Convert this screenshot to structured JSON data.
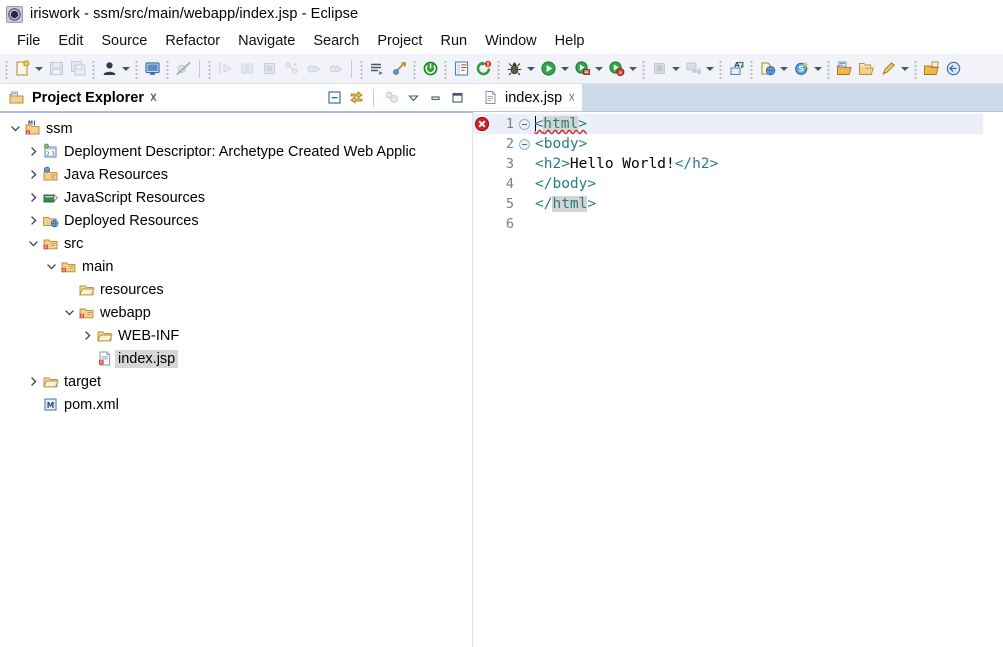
{
  "window": {
    "title": "iriswork - ssm/src/main/webapp/index.jsp - Eclipse",
    "icon": "eclipse-logo-icon"
  },
  "menubar": {
    "items": [
      {
        "label": "File"
      },
      {
        "label": "Edit"
      },
      {
        "label": "Source"
      },
      {
        "label": "Refactor"
      },
      {
        "label": "Navigate"
      },
      {
        "label": "Search"
      },
      {
        "label": "Project"
      },
      {
        "label": "Run"
      },
      {
        "label": "Window"
      },
      {
        "label": "Help"
      }
    ]
  },
  "toolbar": {
    "groups": [
      {
        "items": [
          {
            "name": "new-file-icon",
            "kind": "new",
            "enabled": true
          },
          {
            "name": "new-file-dropdown-arrow",
            "kind": "arrow",
            "enabled": true
          },
          {
            "name": "save-icon",
            "kind": "save",
            "enabled": false
          },
          {
            "name": "save-all-icon",
            "kind": "saveall",
            "enabled": false
          }
        ]
      },
      {
        "items": [
          {
            "name": "user-profile-icon",
            "kind": "person",
            "enabled": true
          },
          {
            "name": "user-profile-dropdown-arrow",
            "kind": "arrow",
            "enabled": true
          }
        ]
      },
      {
        "items": [
          {
            "name": "console-icon",
            "kind": "console",
            "enabled": true
          }
        ]
      },
      {
        "items": [
          {
            "name": "skip-breakpoints-icon",
            "kind": "skipbp",
            "enabled": false
          }
        ]
      },
      {
        "separator": true,
        "items": [
          {
            "name": "step-into-icon",
            "kind": "stepinto",
            "enabled": false
          },
          {
            "name": "step-over-icon",
            "kind": "stepover",
            "enabled": false
          },
          {
            "name": "step-return-icon",
            "kind": "stepreturn",
            "enabled": false
          },
          {
            "name": "drop-to-frame-icon",
            "kind": "dropframe",
            "enabled": false
          },
          {
            "name": "resume-icon",
            "kind": "resume",
            "enabled": false
          },
          {
            "name": "suspend-icon",
            "kind": "suspend",
            "enabled": false
          }
        ]
      },
      {
        "separator": true,
        "items": [
          {
            "name": "next-annotation-icon",
            "kind": "nextanno",
            "enabled": true
          },
          {
            "name": "previous-annotation-icon",
            "kind": "prevanno",
            "enabled": true
          }
        ]
      },
      {
        "items": [
          {
            "name": "start-server-icon",
            "kind": "greenpower",
            "enabled": true
          }
        ]
      },
      {
        "items": [
          {
            "name": "toggle-mark-occurrences-icon",
            "kind": "markocc",
            "enabled": true
          },
          {
            "name": "restore-icon",
            "kind": "restorebadge",
            "enabled": true
          }
        ]
      },
      {
        "items": [
          {
            "name": "debug-icon",
            "kind": "bug",
            "enabled": true
          },
          {
            "name": "debug-dropdown-arrow",
            "kind": "arrow",
            "enabled": true
          },
          {
            "name": "run-icon",
            "kind": "run",
            "enabled": true
          },
          {
            "name": "run-dropdown-arrow",
            "kind": "arrow",
            "enabled": true
          },
          {
            "name": "run-server-icon",
            "kind": "runserver",
            "enabled": true
          },
          {
            "name": "run-server-dropdown-arrow",
            "kind": "arrow",
            "enabled": true
          },
          {
            "name": "coverage-icon",
            "kind": "coverage",
            "enabled": true
          },
          {
            "name": "coverage-dropdown-arrow",
            "kind": "arrow",
            "enabled": true
          }
        ]
      },
      {
        "items": [
          {
            "name": "stop-icon",
            "kind": "stop",
            "enabled": false
          },
          {
            "name": "stop-dropdown-arrow",
            "kind": "arrow",
            "enabled": true
          },
          {
            "name": "external-tools-icon",
            "kind": "exttools",
            "enabled": false
          },
          {
            "name": "external-tools-dropdown-arrow",
            "kind": "arrow",
            "enabled": true
          }
        ]
      },
      {
        "items": [
          {
            "name": "new-java-class-icon",
            "kind": "newclass",
            "enabled": true
          }
        ]
      },
      {
        "items": [
          {
            "name": "new-web-project-icon",
            "kind": "newweb",
            "enabled": true
          },
          {
            "name": "new-web-project-dropdown-arrow",
            "kind": "arrow",
            "enabled": true
          },
          {
            "name": "new-javascript-icon",
            "kind": "newjs",
            "enabled": true
          },
          {
            "name": "new-javascript-dropdown-arrow",
            "kind": "arrow",
            "enabled": true
          }
        ]
      },
      {
        "items": [
          {
            "name": "open-type-icon",
            "kind": "opentype",
            "enabled": true
          },
          {
            "name": "open-task-icon",
            "kind": "opentask",
            "enabled": true
          },
          {
            "name": "search-task-icon",
            "kind": "searchtask",
            "enabled": true
          },
          {
            "name": "search-task-dropdown-arrow",
            "kind": "arrow",
            "enabled": true
          }
        ]
      },
      {
        "items": [
          {
            "name": "open-perspective-icon",
            "kind": "openpersp",
            "enabled": true
          },
          {
            "name": "previous-edit-icon",
            "kind": "prevedit",
            "enabled": true
          }
        ]
      }
    ]
  },
  "explorer": {
    "title": "Project Explorer",
    "close_icon": "close-icon",
    "view_icon": "project-explorer-icon",
    "tools": [
      {
        "name": "collapse-all-icon"
      },
      {
        "name": "link-with-editor-icon"
      },
      {
        "name": "focus-on-active-task-icon"
      },
      {
        "name": "view-menu-icon"
      },
      {
        "name": "minimize-view-icon"
      },
      {
        "name": "maximize-view-icon"
      }
    ],
    "tree": [
      {
        "label": "ssm",
        "depth": 0,
        "twisty": "expanded",
        "icon": "maven-web-project-icon",
        "selected": false
      },
      {
        "label": "Deployment Descriptor: Archetype Created Web Applic",
        "depth": 1,
        "twisty": "collapsed",
        "icon": "deployment-descriptor-icon",
        "selected": false,
        "truncated": true
      },
      {
        "label": "Java Resources",
        "depth": 1,
        "twisty": "collapsed",
        "icon": "java-resources-icon",
        "selected": false
      },
      {
        "label": "JavaScript Resources",
        "depth": 1,
        "twisty": "collapsed",
        "icon": "javascript-resources-icon",
        "selected": false
      },
      {
        "label": "Deployed Resources",
        "depth": 1,
        "twisty": "collapsed",
        "icon": "deployed-resources-icon",
        "selected": false
      },
      {
        "label": "src",
        "depth": 1,
        "twisty": "expanded",
        "icon": "source-folder-icon",
        "selected": false
      },
      {
        "label": "main",
        "depth": 2,
        "twisty": "expanded",
        "icon": "source-folder-icon",
        "selected": false
      },
      {
        "label": "resources",
        "depth": 3,
        "twisty": "none",
        "icon": "folder-icon",
        "selected": false
      },
      {
        "label": "webapp",
        "depth": 3,
        "twisty": "expanded",
        "icon": "source-folder-icon",
        "selected": false
      },
      {
        "label": "WEB-INF",
        "depth": 4,
        "twisty": "collapsed",
        "icon": "folder-icon",
        "selected": false
      },
      {
        "label": "index.jsp",
        "depth": 4,
        "twisty": "none",
        "icon": "jsp-file-icon",
        "selected": true
      },
      {
        "label": "target",
        "depth": 1,
        "twisty": "collapsed",
        "icon": "folder-icon",
        "selected": false
      },
      {
        "label": "pom.xml",
        "depth": 1,
        "twisty": "none",
        "icon": "maven-pom-icon",
        "selected": false
      }
    ]
  },
  "editor": {
    "tab": {
      "label": "index.jsp",
      "icon": "jsp-editor-icon",
      "close_icon": "close-icon",
      "active": true
    },
    "lines": [
      {
        "number": "1",
        "fold": true,
        "marker": "error",
        "current": true,
        "caret": true,
        "segments": [
          {
            "text": "<",
            "style": "tag"
          },
          {
            "text": "html",
            "style": "tag-highlight"
          },
          {
            "text": ">",
            "style": "tag"
          }
        ]
      },
      {
        "number": "2",
        "fold": true,
        "marker": "none",
        "current": false,
        "caret": false,
        "segments": [
          {
            "text": "<body>",
            "style": "tag"
          }
        ]
      },
      {
        "number": "3",
        "fold": false,
        "marker": "none",
        "current": false,
        "caret": false,
        "segments": [
          {
            "text": "<h2>",
            "style": "tag"
          },
          {
            "text": "Hello World!",
            "style": "text"
          },
          {
            "text": "</h2>",
            "style": "tag"
          }
        ]
      },
      {
        "number": "4",
        "fold": false,
        "marker": "none",
        "current": false,
        "caret": false,
        "segments": [
          {
            "text": "</body>",
            "style": "tag"
          }
        ]
      },
      {
        "number": "5",
        "fold": false,
        "marker": "none",
        "current": false,
        "caret": false,
        "segments": [
          {
            "text": "</",
            "style": "tag"
          },
          {
            "text": "html",
            "style": "tag-highlight"
          },
          {
            "text": ">",
            "style": "tag"
          }
        ]
      },
      {
        "number": "6",
        "fold": false,
        "marker": "none",
        "current": false,
        "caret": false,
        "segments": []
      }
    ]
  },
  "colors": {
    "tag": "#2a7d7d",
    "text": "#000000",
    "current_line": "#eaeffa",
    "selection": "#d6d6d6",
    "tab_strip": "#cddaec",
    "toolbar_bg": "#f2f3f8",
    "error": "#cc2222",
    "accent": "#a8c0dd"
  }
}
